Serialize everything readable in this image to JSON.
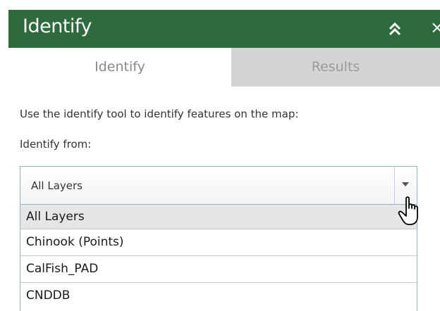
{
  "header": {
    "title": "Identify",
    "collapse_icon": "double-chevron-up-icon",
    "close_icon": "close-icon",
    "close_glyph": "×",
    "background_color": "#2d6a3c"
  },
  "tabs": [
    {
      "label": "Identify",
      "active": true
    },
    {
      "label": "Results",
      "active": false
    }
  ],
  "panel": {
    "instructions": "Use the identify tool to identify features on the map:",
    "identify_from_label": "Identify from:"
  },
  "select": {
    "value": "All Layers",
    "arrow_icon": "chevron-down-icon",
    "options": [
      {
        "label": "All Layers",
        "highlighted": true
      },
      {
        "label": "Chinook (Points)",
        "highlighted": false
      },
      {
        "label": "CalFish_PAD",
        "highlighted": false
      },
      {
        "label": "CNDDB",
        "highlighted": false
      }
    ]
  },
  "cursor": {
    "icon": "hand-pointer-icon"
  }
}
